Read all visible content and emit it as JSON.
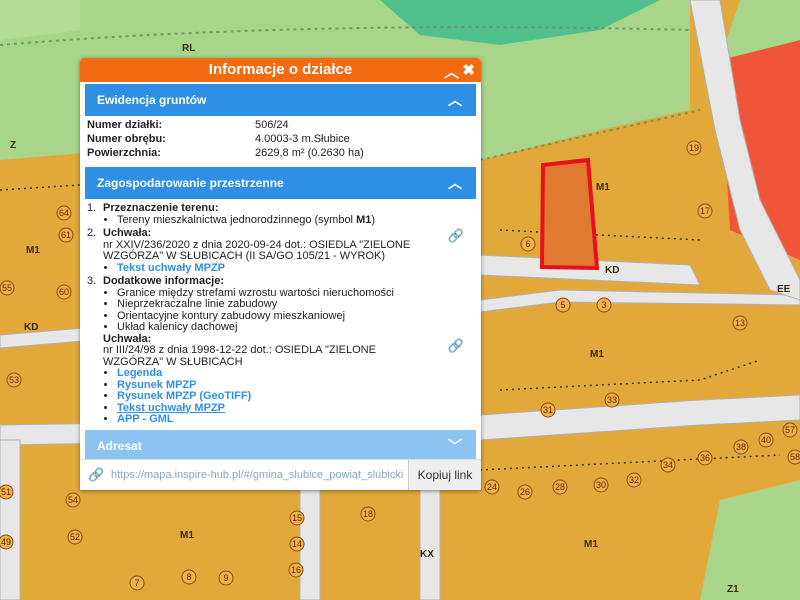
{
  "map": {
    "labels": {
      "rl": "RL",
      "z": "Z",
      "m1_top": "M1",
      "m1_left": "M1",
      "kd_left": "KD",
      "kd_mid": "KD",
      "m1_mid": "M1",
      "m1_bottom_left": "M1",
      "m1_bottom_right": "M1",
      "kx": "KX",
      "z1": "Z1",
      "ee": "EE"
    },
    "parcels": [
      "64",
      "61",
      "55",
      "60",
      "53",
      "54",
      "52",
      "51",
      "49",
      "7",
      "8",
      "9",
      "15",
      "14",
      "16",
      "18",
      "19",
      "17",
      "6",
      "5",
      "3",
      "13",
      "31",
      "33",
      "24",
      "26",
      "28",
      "30",
      "32",
      "34",
      "36",
      "38",
      "40",
      "57",
      "58"
    ]
  },
  "panel": {
    "title": "Informacje o działce",
    "collapse_icon": "chevron-up-icon",
    "close_icon": "close-icon",
    "sections": {
      "ewidencja": {
        "label": "Ewidencja gruntów",
        "rows": [
          {
            "key": "Numer działki:",
            "value": "506/24"
          },
          {
            "key": "Numer obrębu:",
            "value": "4.0003-3 m.Słubice"
          },
          {
            "key": "Powierzchnia:",
            "value": "2629,8 m² (0.2630 ha)"
          }
        ]
      },
      "zagospodarowanie": {
        "label": "Zagospodarowanie przestrzenne",
        "item1_head": "Przeznaczenie terenu:",
        "item1_text": "Tereny mieszkalnictwa jednorodzinnego (symbol ",
        "item1_symbol": "M1",
        "item1_close": ")",
        "item2_head": "Uchwała:",
        "item2_text": "nr XXIV/236/2020 z dnia 2020-09-24 dot.: OSIEDLA \"ZIELONE WZGÓRZA\" W SŁUBICACH (II SA/GO 105/21 - WYROK)",
        "item2_link": "Tekst uchwały MPZP",
        "item3_head": "Dodatkowe informacje:",
        "item3_list": [
          "Granice między strefami wzrostu wartości nieruchomości",
          "Nieprzekraczalne linie zabudowy",
          "Orientacyjne kontury zabudowy mieszkaniowej",
          "Układ kalenicy dachowej"
        ],
        "item3_uchwala_head": "Uchwała:",
        "item3_uchwala_text": "nr III/24/98 z dnia 1998-12-22 dot.: OSIEDLA \"ZIELONE WZGÓRZA\" W SŁUBICACH",
        "item3_links": [
          "Legenda",
          "Rysunek MPZP",
          "Rysunek MPZP (GeoTIFF)",
          "Tekst uchwały MPZP",
          "APP - GML"
        ]
      },
      "adresat": {
        "label": "Adresat"
      }
    },
    "footer": {
      "url": "https://mapa.inspire-hub.pl/#/gmina_slubice_powiat_slubicki",
      "copy_label": "Kopiuj link"
    }
  },
  "colors": {
    "header": "#f26a12",
    "section_active": "#2e8fe6",
    "section_collapsed": "#8cc3f2",
    "parcel_highlight": "#e8101a",
    "zone_orange": "#e3a83a",
    "zone_green": "#a8d58a",
    "zone_red": "#f0553a"
  }
}
